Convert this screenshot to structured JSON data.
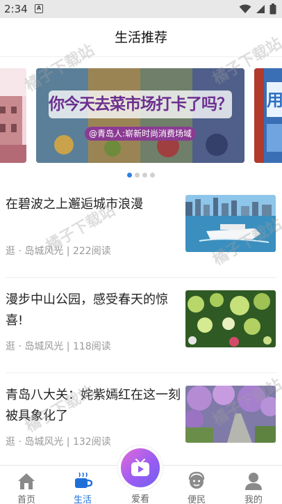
{
  "status_bar": {
    "time": "2:34",
    "notification_letter": "A"
  },
  "header": {
    "title": "生活推荐"
  },
  "banner": {
    "headline": "你今天去菜市场打卡了吗？",
    "subline": "@青岛人:崭新时尚消费场域",
    "next_edge_text": "用",
    "active_index": 0,
    "dot_count": 4
  },
  "watermark": "橘子下载站",
  "articles": [
    {
      "title": "在碧波之上邂逅城市浪漫",
      "meta": "逛 · 岛城风光 | 222阅读",
      "image": "harbor-ferry"
    },
    {
      "title": "漫步中山公园，感受春天的惊喜!",
      "meta": "逛 · 岛城风光 | 118阅读",
      "image": "spring-flowers"
    },
    {
      "title": "青岛八大关：姹紫嫣红在这一刻被具象化了",
      "meta": "逛 · 岛城风光 | 132阅读",
      "image": "purple-blossom-road"
    }
  ],
  "bottom_nav": {
    "items": [
      {
        "label": "首页",
        "icon": "home-icon",
        "active": false
      },
      {
        "label": "生活",
        "icon": "coffee-cup-icon",
        "active": true
      },
      {
        "label": "爱看",
        "icon": "tv-play-icon",
        "active": false
      },
      {
        "label": "便民",
        "icon": "service-face-icon",
        "active": false
      },
      {
        "label": "我的",
        "icon": "user-icon",
        "active": false
      }
    ]
  },
  "colors": {
    "accent": "#1f6fd9",
    "dot_active": "#2f7fe5",
    "meta_text": "#999999"
  }
}
